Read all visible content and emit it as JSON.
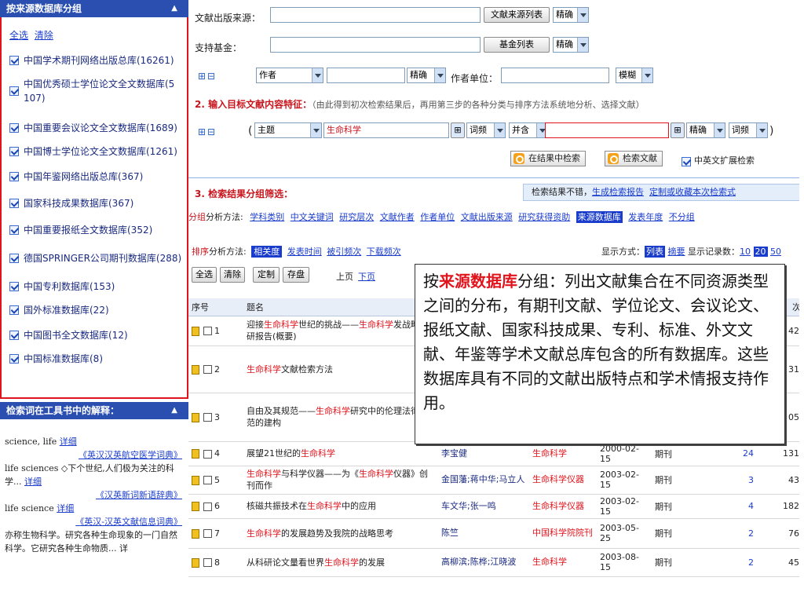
{
  "sidebar": {
    "db_group": {
      "title": "按来源数据库分组",
      "select_all": "全选",
      "clear": "清除",
      "items": [
        {
          "label": "中国学术期刊网络出版总库(16261)"
        },
        {
          "label": "中国优秀硕士学位论文全文数据库(5",
          "label2": "107)"
        },
        {
          "label": "中国重要会议论文全文数据库(1689)"
        },
        {
          "label": "中国博士学位论文全文数据库(1261)"
        },
        {
          "label": "中国年鉴网络出版总库(367)"
        },
        {
          "label": "国家科技成果数据库(367)"
        },
        {
          "label": "中国重要报纸全文数据库(352)"
        },
        {
          "label": "德国SPRINGER公司期刊数据库(288)"
        },
        {
          "label": "中国专利数据库(153)"
        },
        {
          "label": "国外标准数据库(22)"
        },
        {
          "label": "中国图书全文数据库(12)"
        },
        {
          "label": "中国标准数据库(8)"
        }
      ]
    },
    "tool": {
      "title": "检索词在工具书中的解释：",
      "entries": [
        {
          "text": "science, life",
          "link": "详细",
          "source": "《英汉汉英航空医学词典》"
        },
        {
          "text": "life sciences ◇下个世纪,人们极为关注的科学...",
          "link": "详细",
          "source": "《汉英新词新语辞典》"
        },
        {
          "text": "life science",
          "link": "详细",
          "source": "《英汉-汉英文献信息词典》"
        },
        {
          "text": "亦称生物科学。研究各种生命现象的一门自然科学。它研究各种生命物质... 详",
          "link": "",
          "source": ""
        }
      ]
    }
  },
  "form": {
    "source_label": "文献出版来源：",
    "source_list_btn": "文献来源列表",
    "exact": "精确",
    "fund_label": "支持基金：",
    "fund_list_btn": "基金列表",
    "plusminus": "⊞⊟",
    "author_select": "作者",
    "author_org_label": "作者单位：",
    "fuzzy": "模糊",
    "step2_title": "2. 输入目标文献内容特征：",
    "step2_hint": "（由此得到初次检索结果后，再用第三步的各种分类与排序方法系统地分析、选择文献）",
    "paren_open": "(",
    "paren_close": ")",
    "topic_select": "主题",
    "topic_value": "生命科学",
    "freq": "词频",
    "and": "并含",
    "search_in_results": "在结果中检索",
    "search": "检索文献",
    "cn_en_expand": "中英文扩展检索"
  },
  "step3": {
    "title": "3. 检索结果分组筛选：",
    "notice": "检索结果不错，",
    "notice_links": [
      "生成检索报告",
      "定制或收藏本次检索式"
    ],
    "group_label_red": "分组",
    "group_label": "分析方法:",
    "group_links": [
      "学科类别",
      "中文关键词",
      "研究层次",
      "文献作者",
      "作者单位",
      "文献出版来源",
      "研究获得资助"
    ],
    "group_active": "来源数据库",
    "group_links2": [
      "发表年度",
      "不分组"
    ],
    "sort_label_red": "排序",
    "sort_label": "分析方法:",
    "sort_active": "相关度",
    "sort_links": [
      "发表时间",
      "被引频次",
      "下载频次"
    ],
    "display_label": "显示方式：",
    "display_active": "列表",
    "display_abstract": "摘要",
    "count_label": "显示记录数：",
    "count_options": [
      "10",
      "20",
      "50"
    ],
    "count_active": "20"
  },
  "toolbar": {
    "select_all": "全选",
    "clear": "清除",
    "custom": "定制",
    "save": "存盘",
    "prev": "上页",
    "next": "下页"
  },
  "table": {
    "headers": [
      "序号",
      "题名",
      "",
      "",
      "",
      "",
      "",
      "次"
    ],
    "rows": [
      {
        "no": "1",
        "title": [
          "迎接",
          "生命科学",
          "世纪的挑战——",
          "生命科学",
          "发",
          "战略调研报告(概要)"
        ],
        "author": "",
        "source": "",
        "date": "",
        "type": "",
        "cited": "",
        "dl": "42"
      },
      {
        "no": "2",
        "title": [
          "",
          "生命科学",
          "文献检索方法"
        ],
        "author": "",
        "source": "",
        "date": "",
        "type": "",
        "cited": "",
        "dl": "31"
      },
      {
        "no": "3",
        "title": [
          "自由及其规范——",
          "生命科学",
          "研究中的伦理",
          "法律规范的建构"
        ],
        "author": "",
        "source": "科学版)",
        "date": "",
        "type": "",
        "cited": "",
        "dl": "05"
      },
      {
        "no": "4",
        "title": [
          "展望21世纪的",
          "生命科学",
          ""
        ],
        "author": "李宝健",
        "source": "生命科学",
        "date": "2000-02-15",
        "type": "期刊",
        "cited": "24",
        "dl": "131"
      },
      {
        "no": "5",
        "title": [
          "",
          "生命科学",
          "与科学仪器——为《",
          "生命科学",
          "仪",
          "器》创刊而作"
        ],
        "author": "金国藩;蒋中华;马立人",
        "source": "生命科学仪器",
        "date": "2003-02-15",
        "type": "期刊",
        "cited": "3",
        "dl": "43"
      },
      {
        "no": "6",
        "title": [
          "核磁共振技术在",
          "生命科学",
          "中的应用"
        ],
        "author": "车文华;张一鸣",
        "source": "生命科学仪器",
        "date": "2003-02-15",
        "type": "期刊",
        "cited": "4",
        "dl": "182"
      },
      {
        "no": "7",
        "title": [
          "",
          "生命科学",
          "的发展趋势及我院的战略思考"
        ],
        "author": "陈竺",
        "source": "中国科学院院刊",
        "date": "2003-05-25",
        "type": "期刊",
        "cited": "2",
        "dl": "76"
      },
      {
        "no": "8",
        "title": [
          "从科研论文量看世界",
          "生命科学",
          "的发展"
        ],
        "author": "高柳滨;陈桦;江晓波",
        "source": "生命科学",
        "date": "2003-08-15",
        "type": "期刊",
        "cited": "2",
        "dl": "45"
      }
    ]
  },
  "callout": {
    "prefix": "按",
    "highlight": "来源数据库",
    "body": "分组：列出文献集合在不同资源类型之间的分布，有期刊文献、学位论文、会议论文、报纸文献、国家科技成果、专利、标准、外文文献、年鉴等学术文献总库包含的所有数据库。这些数据库具有不同的文献出版特点和学术情报支持作用。"
  },
  "colors": {
    "accent_blue": "#2a4fb0",
    "highlight_red": "#e0141c"
  }
}
